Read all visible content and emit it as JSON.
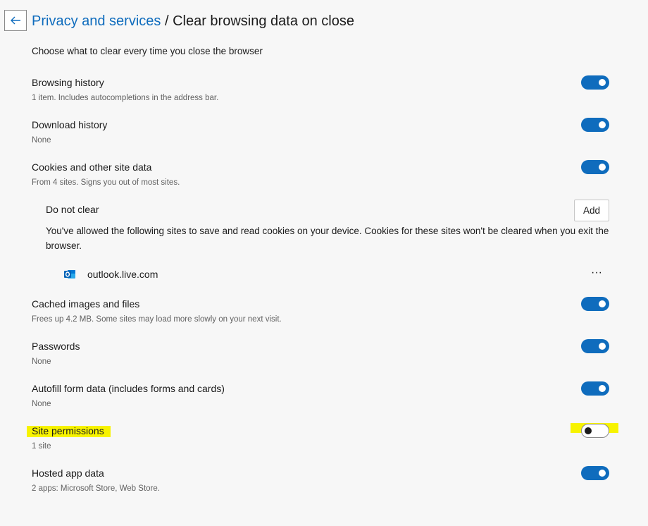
{
  "header": {
    "back_label": "Back",
    "breadcrumb_parent": "Privacy and services",
    "separator": " / ",
    "title": "Clear browsing data on close"
  },
  "subtitle": "Choose what to clear every time you close the browser",
  "items": [
    {
      "title": "Browsing history",
      "desc": "1 item. Includes autocompletions in the address bar.",
      "on": true
    },
    {
      "title": "Download history",
      "desc": "None",
      "on": true
    },
    {
      "title": "Cookies and other site data",
      "desc": "From 4 sites. Signs you out of most sites.",
      "on": true
    },
    {
      "title": "Cached images and files",
      "desc": "Frees up 4.2 MB. Some sites may load more slowly on your next visit.",
      "on": true
    },
    {
      "title": "Passwords",
      "desc": "None",
      "on": true
    },
    {
      "title": "Autofill form data (includes forms and cards)",
      "desc": "None",
      "on": true
    },
    {
      "title": "Site permissions",
      "desc": "1 site",
      "on": false
    },
    {
      "title": "Hosted app data",
      "desc": "2 apps: Microsoft Store, Web Store.",
      "on": true
    }
  ],
  "do_not_clear": {
    "title": "Do not clear",
    "add_label": "Add",
    "description": "You've allowed the following sites to save and read cookies on your device. Cookies for these sites won't be cleared when you exit the browser.",
    "sites": [
      {
        "name": "outlook.live.com",
        "icon": "outlook-icon"
      }
    ],
    "more_label": "···"
  },
  "colors": {
    "accent": "#0f6cbd",
    "highlight": "#f7f300",
    "background": "#f7f7f7"
  }
}
